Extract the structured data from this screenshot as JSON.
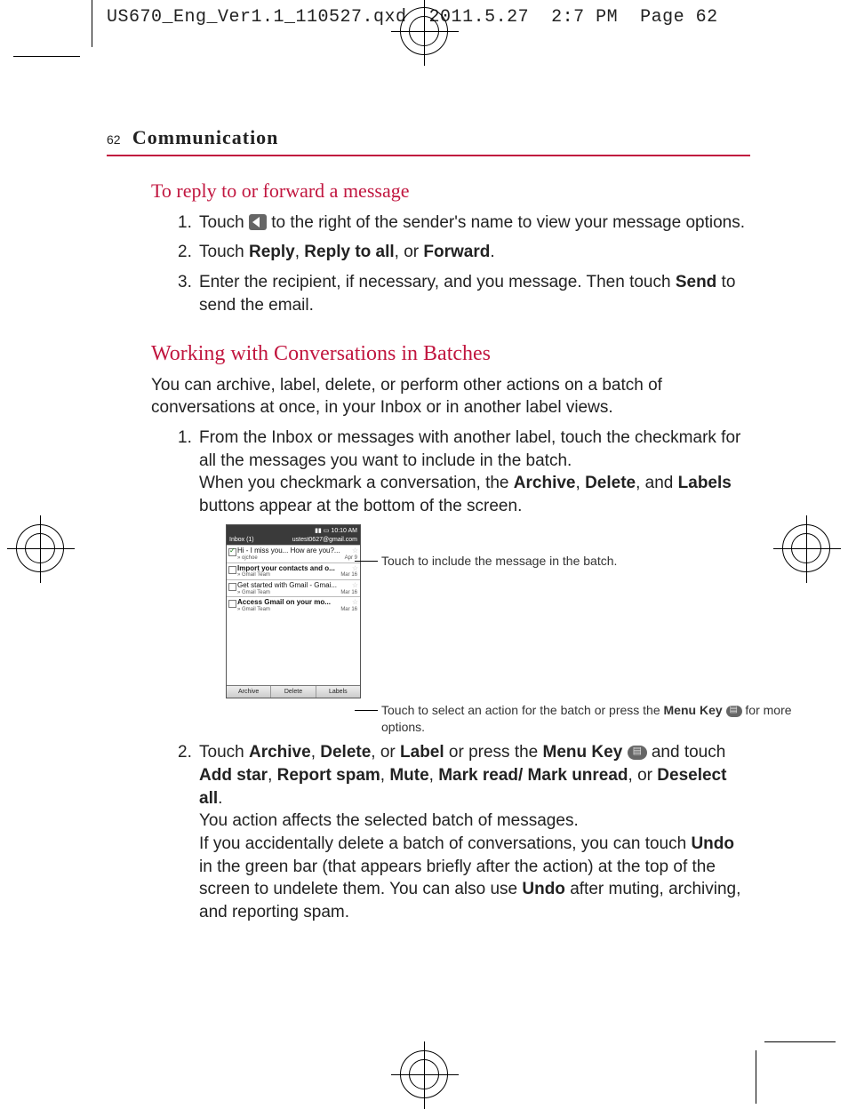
{
  "slug": "US670_Eng_Ver1.1_110527.qxd  2011.5.27  2:7 PM  Page 62",
  "page_number": "62",
  "section_title": "Communication",
  "h_reply": "To reply to or forward a message",
  "reply_steps": {
    "1": {
      "num": "1.",
      "pre": "Touch ",
      "post": " to the right of the sender's name to view your message options."
    },
    "2": {
      "num": "2.",
      "pre": "Touch ",
      "b1": "Reply",
      "sep1": ", ",
      "b2": "Reply to all",
      "sep2": ", or ",
      "b3": "Forward",
      "post": "."
    },
    "3": {
      "num": "3.",
      "pre": "Enter the recipient, if necessary, and you message. Then touch ",
      "b1": "Send",
      "post": " to send the email."
    }
  },
  "h_batches": "Working with Conversations in Batches",
  "batches_intro": "You can archive, label, delete, or perform other actions on a batch of conversations at once, in your Inbox or in another label views.",
  "batches_steps": {
    "1": {
      "num": "1.",
      "p1": "From the Inbox or messages with another label, touch the checkmark for all the messages you want to include in the batch.",
      "p2_pre": "When you checkmark a conversation, the ",
      "p2_b1": "Archive",
      "p2_s1": ", ",
      "p2_b2": "Delete",
      "p2_s2": ", and ",
      "p2_b3": "Labels",
      "p2_post": " buttons appear at the bottom of the screen."
    },
    "2": {
      "num": "2.",
      "p1_pre": "Touch ",
      "p1_b1": "Archive",
      "p1_s1": ", ",
      "p1_b2": "Delete",
      "p1_s2": ", or ",
      "p1_b3": "Label",
      "p1_s3": " or press the ",
      "p1_b4": "Menu Key",
      "p1_mid": " and touch ",
      "p1_b5": "Add star",
      "p1_s5": ", ",
      "p1_b6": "Report spam",
      "p1_s6": ", ",
      "p1_b7": "Mute",
      "p1_s7": ", ",
      "p1_b8": "Mark read/ Mark unread",
      "p1_s8": ", or ",
      "p1_b9": "Deselect all",
      "p1_post": ".",
      "p2": "You action affects the selected batch of messages.",
      "p3_pre": "If you accidentally delete a batch of conversations, you can touch ",
      "p3_b1": "Undo",
      "p3_mid": " in the green bar (that appears briefly after the action) at the top of the screen to undelete them. You can also use ",
      "p3_b2": "Undo",
      "p3_post": " after muting, archiving, and reporting spam."
    }
  },
  "callouts": {
    "top": "Touch to include the message in the batch.",
    "bottom_pre": "Touch to select an action for the batch or press the ",
    "bottom_b": "Menu Key",
    "bottom_post": " for more options."
  },
  "screenshot": {
    "time": "10:10 AM",
    "inbox_label": "Inbox (1)",
    "account": "ustest0627@gmail.com",
    "rows": [
      {
        "subject": "Hi - I miss you... How are you?...",
        "sender": "» ojchoe",
        "date": "Apr 9",
        "checked": true,
        "bold": false
      },
      {
        "subject": "Import your contacts and o...",
        "sender": "» Gmail Team",
        "date": "Mar 16",
        "checked": false,
        "bold": true
      },
      {
        "subject": "Get started with Gmail - Gmai...",
        "sender": "» Gmail Team",
        "date": "Mar 16",
        "checked": false,
        "bold": false
      },
      {
        "subject": "Access Gmail on your mo...",
        "sender": "» Gmail Team",
        "date": "Mar 16",
        "checked": false,
        "bold": true
      }
    ],
    "buttons": [
      "Archive",
      "Delete",
      "Labels"
    ]
  }
}
